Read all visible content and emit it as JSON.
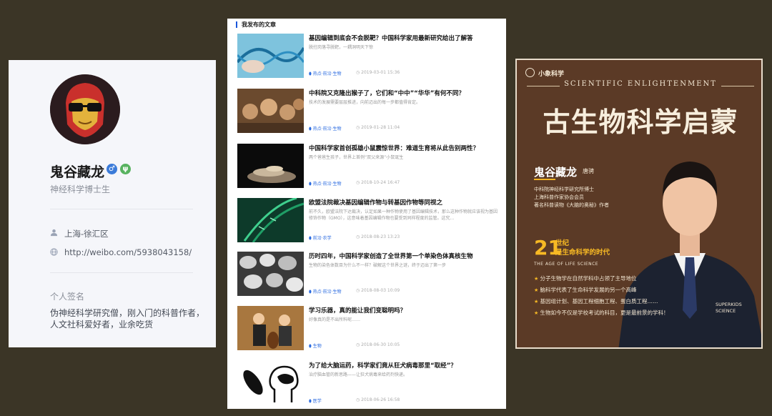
{
  "profile": {
    "name": "鬼谷藏龙",
    "gender_badge": "♂",
    "verify_badge": "ψ",
    "title": "神经科学博士生",
    "location": "上海-徐汇区",
    "website": "http://weibo.com/5938043158/",
    "signature_label": "个人签名",
    "signature": "伪神经科学研究僧，刚入门的科普作者，人文社科爱好者，业余吃货"
  },
  "articles": {
    "heading": "我发布的文章",
    "items": [
      {
        "title": "基因编辑到底会不会脱靶？中国科学家用最新研究给出了解答",
        "summary": "脱拄岗落寻脱靶，一耦洞明天下惊",
        "tag": "热点·前沿·生物",
        "date": "2019-03-01 15:36"
      },
      {
        "title": "中科院又克隆出猴子了，它们和“中中”“华华”有何不同？",
        "summary": "技术的发展需要层层推进，向前迈出的每一步都值得肯定。",
        "tag": "热点·前沿·生物",
        "date": "2019-01-28 11:04"
      },
      {
        "title": "中国科学家首创孤雄小鼠震惊世界：难道生育将从此告别两性？",
        "summary": "两个爸爸生孩子，世界上首例“双父来源”小鼠诞生",
        "tag": "热点·前沿·生物",
        "date": "2018-10-24 16:47"
      },
      {
        "title": "欧盟法院裁决基因编辑作物与转基因作物等同视之",
        "summary": "前不久，欧盟法院下达裁决，认定如果一种作物使用了基因编辑技术，那么这种作物就应该视为基因修饰作物（GMO），这意味着基因编辑作物也要受到同样程度的监管。这究...",
        "tag": "前沿·农学",
        "date": "2018-08-23 13:23"
      },
      {
        "title": "历时四年，中国科学家创造了全世界第一个单染色体真核生物",
        "summary": "生物的染色体数目为什么不一样？破解这个世界之谜，终于迈出了第一步",
        "tag": "热点·前沿·生物",
        "date": "2018-08-03 10:09"
      },
      {
        "title": "学习乐器，真的能让我们变聪明吗？",
        "summary": "好像真的是不出所料呢……",
        "tag": "生物",
        "date": "2018-06-30 10:05"
      },
      {
        "title": "为了给大脑运药，科学家们竟从狂犬病毒那里“取经”？",
        "summary": "治疗脑血管的新思路——让狂犬病毒来给药剂快递。",
        "tag": "医学",
        "date": "2018-06-26 16:58"
      }
    ]
  },
  "poster": {
    "brand": "小象科学",
    "subtitle": "SCIENTIFIC ENLIGHTENMENT",
    "title": "古生物科学启蒙",
    "name": "鬼谷藏龙",
    "real_name": "唐骋",
    "credentials": [
      "中科院神经科学研究所博士",
      "上海科普作家协会会员",
      "著名科普读物《大脑的奥秘》作者"
    ],
    "century_number": "21",
    "century_line1": "世纪",
    "century_line2": "是生命科学的时代",
    "age_label": "THE AGE OF LIFE SCIENCE",
    "bullets": [
      "分子生物学在自然学科中占领了主导地位",
      "脑科学代表了生命科学发展的另一个高峰",
      "基因组计划、基因工程细胞工程、蛋白质工程……",
      "生物如今不仅是学校考试的科目，更是最前景的学科！"
    ],
    "brand_bottom": [
      "SUPERKIDS",
      "SCIENCE"
    ]
  }
}
